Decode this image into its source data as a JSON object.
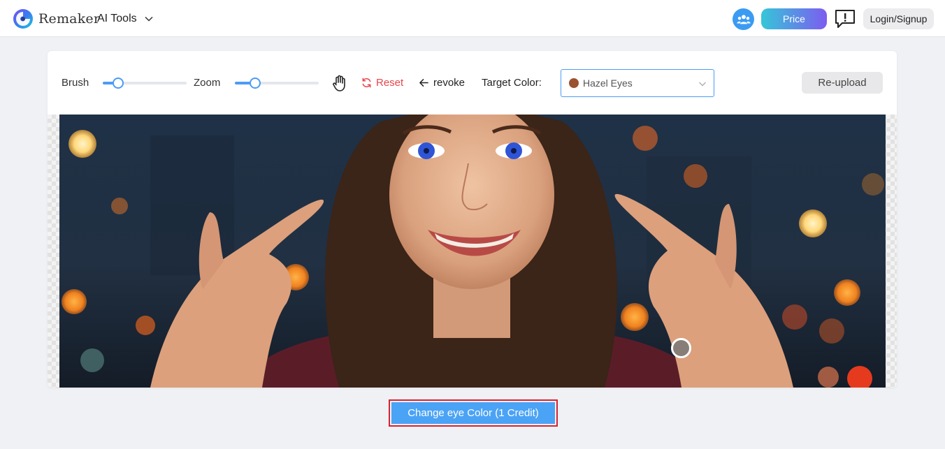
{
  "header": {
    "brand": "Remaker",
    "ai_tools_label": "AI Tools",
    "price_label": "Price",
    "login_label": "Login/Signup",
    "icons": {
      "logo": "remaker-logo",
      "ai_tools_chevron": "chevron-down-icon",
      "community": "community-icon",
      "feedback": "feedback-icon"
    }
  },
  "toolbar": {
    "brush_label": "Brush",
    "brush_value": 0.18,
    "zoom_label": "Zoom",
    "zoom_value": 0.24,
    "pan_icon": "hand-icon",
    "reset_label": "Reset",
    "revoke_label": "revoke",
    "target_color_label": "Target Color:",
    "target_color_value": "Hazel Eyes",
    "target_color_swatch": "#9a5231",
    "reupload_label": "Re-upload"
  },
  "action": {
    "change_button_label": "Change eye Color (1 Credit)"
  },
  "colors": {
    "accent": "#4c9bf5",
    "reset_red": "#e8454b",
    "button_blue": "#4ba3f5",
    "highlight_border": "#d8222f",
    "price_gradient_start": "#35c6d8",
    "price_gradient_end": "#7d5cf0"
  }
}
